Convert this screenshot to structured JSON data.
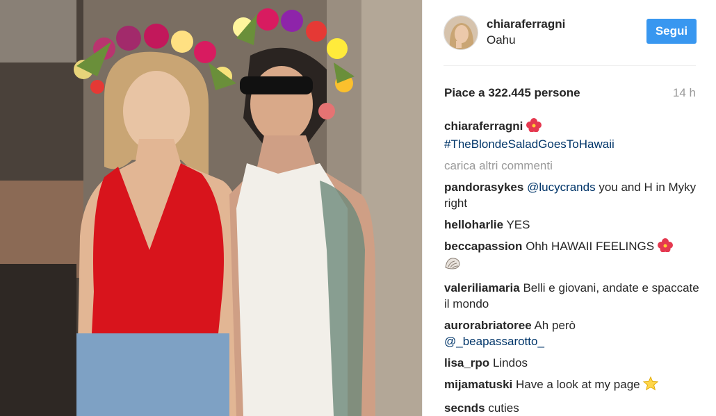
{
  "post": {
    "username": "chiaraferragni",
    "location": "Oahu",
    "follow_label": "Segui",
    "likes_text": "Piace a 322.445 persone",
    "time_ago": "14 h"
  },
  "caption": {
    "author": "chiaraferragni",
    "hashtag": "#TheBlondeSaladGoesToHawaii",
    "emoji": "hibiscus-icon"
  },
  "load_more_label": "carica altri commenti",
  "comments": [
    {
      "author": "pandorasykes",
      "mention": "@lucycrands",
      "text": " you and H in Myky right"
    },
    {
      "author": "helloharlie",
      "text": "YES"
    },
    {
      "author": "beccapassion",
      "text": "Ohh HAWAII FEELINGS",
      "emoji": [
        "hibiscus-icon",
        "shell-icon"
      ]
    },
    {
      "author": "valeriliamaria",
      "text": "Belli e giovani, andate e spaccate il mondo"
    },
    {
      "author": "aurorabriatoree",
      "text": "Ah però",
      "mention": "@_beapassarotto_"
    },
    {
      "author": "lisa_rpo",
      "text": "Lindos"
    },
    {
      "author": "mijamatuski",
      "text": "Have a look at my page",
      "emoji": "star-icon"
    },
    {
      "author": "secnds",
      "text": "cuties"
    }
  ],
  "colors": {
    "accent": "#3897f0",
    "link": "#003569",
    "muted": "#999999",
    "text": "#262626"
  }
}
